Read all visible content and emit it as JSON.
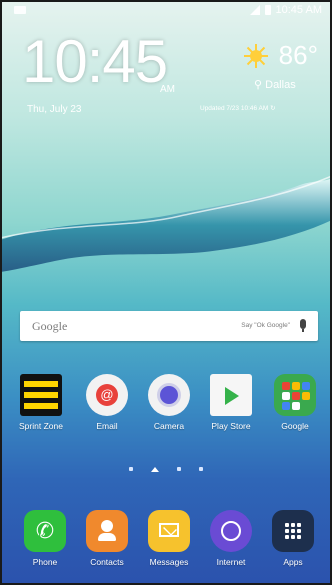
{
  "status_bar": {
    "time": "10:45 AM"
  },
  "clock": {
    "time": "10:45",
    "ampm": "AM",
    "date": "Thu, July 23"
  },
  "weather": {
    "temp": "86°",
    "city": "Dallas",
    "updated": "Updated 7/23 10:46 AM"
  },
  "search": {
    "logo": "Google",
    "hint": "Say \"Ok Google\""
  },
  "apps": [
    {
      "label": "Sprint Zone",
      "icon": "sprint-zone-icon"
    },
    {
      "label": "Email",
      "icon": "email-icon"
    },
    {
      "label": "Camera",
      "icon": "camera-icon"
    },
    {
      "label": "Play Store",
      "icon": "play-store-icon"
    },
    {
      "label": "Google",
      "icon": "google-folder-icon"
    }
  ],
  "dock": [
    {
      "label": "Phone",
      "icon": "phone-icon"
    },
    {
      "label": "Contacts",
      "icon": "contacts-icon"
    },
    {
      "label": "Messages",
      "icon": "messages-icon"
    },
    {
      "label": "Internet",
      "icon": "internet-icon"
    },
    {
      "label": "Apps",
      "icon": "apps-grid-icon"
    }
  ],
  "pager": {
    "pages": 4,
    "current": 2
  }
}
